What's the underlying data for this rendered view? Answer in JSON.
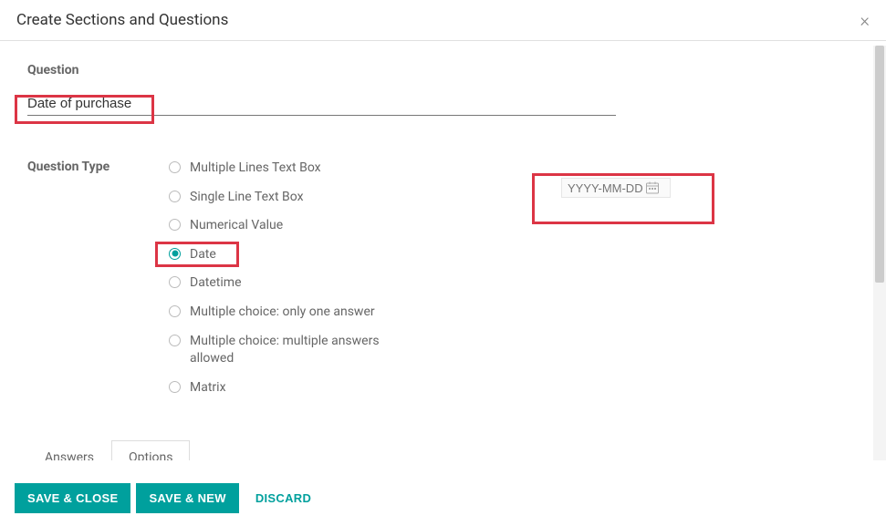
{
  "header": {
    "title": "Create Sections and Questions"
  },
  "form": {
    "question_label": "Question",
    "question_value": "Date of purchase",
    "question_type_label": "Question Type",
    "types": [
      {
        "label": "Multiple Lines Text Box",
        "selected": false
      },
      {
        "label": "Single Line Text Box",
        "selected": false
      },
      {
        "label": "Numerical Value",
        "selected": false
      },
      {
        "label": "Date",
        "selected": true
      },
      {
        "label": "Datetime",
        "selected": false
      },
      {
        "label": "Multiple choice: only one answer",
        "selected": false
      },
      {
        "label": "Multiple choice: multiple answers allowed",
        "selected": false
      },
      {
        "label": "Matrix",
        "selected": false
      }
    ],
    "preview": {
      "placeholder": "YYYY-MM-DD"
    }
  },
  "tabs": {
    "answers": "Answers",
    "options": "Options"
  },
  "footer": {
    "save_close": "SAVE & CLOSE",
    "save_new": "SAVE & NEW",
    "discard": "DISCARD"
  }
}
